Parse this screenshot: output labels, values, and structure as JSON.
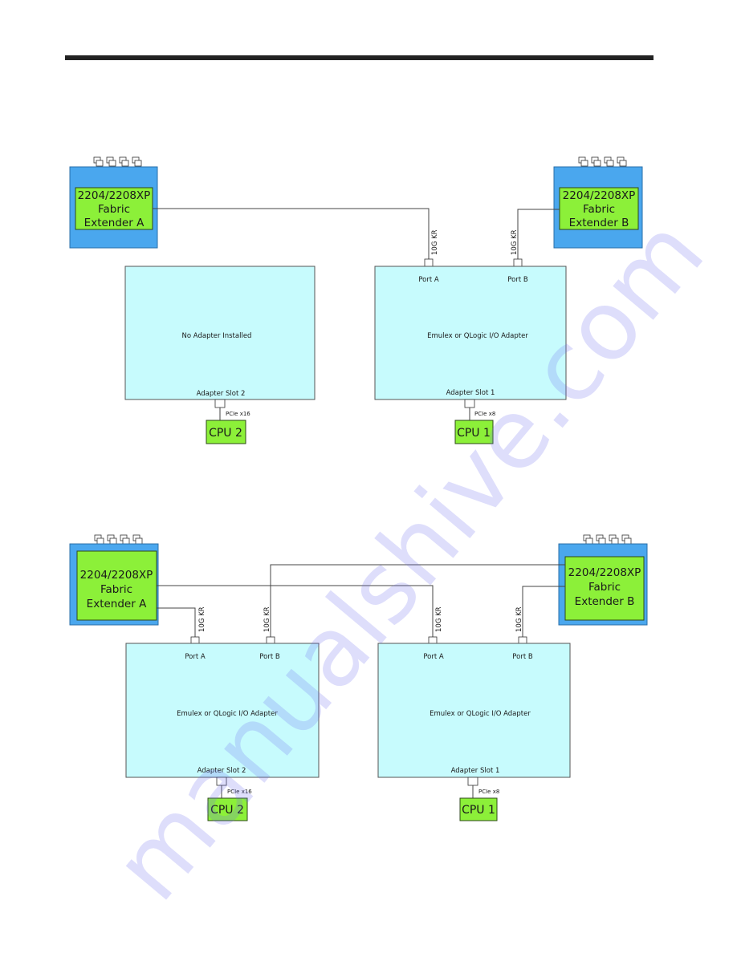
{
  "page": {
    "watermark": "manualshive.com"
  },
  "colors": {
    "fex_outer": "#4aa7ee",
    "fex_inner": "#8cf039",
    "adapter_fill": "#c7fbfd",
    "cpu_fill": "#8cf039",
    "wire": "#444444",
    "rule": "#222222"
  },
  "diagrams": [
    {
      "fex_a": {
        "lines": [
          "2204/2208XP",
          "Fabric",
          "Extender A"
        ]
      },
      "fex_b": {
        "lines": [
          "2204/2208XP",
          "Fabric",
          "Extender B"
        ]
      },
      "links": [
        {
          "label": "10G KR",
          "from": "Fabric Extender A",
          "to": "Adapter Slot 1 Port A"
        },
        {
          "label": "10G KR",
          "from": "Fabric Extender B",
          "to": "Adapter Slot 1 Port B"
        }
      ],
      "adapters": [
        {
          "slot": "Adapter Slot 2",
          "name": "No  Adapter Installed",
          "ports": [],
          "bus": "PCIe x16",
          "cpu": "CPU 2"
        },
        {
          "slot": "Adapter Slot 1",
          "name": "Emulex or QLogic I/O Adapter",
          "ports": [
            "Port  A",
            "Port  B"
          ],
          "bus": "PCIe x8",
          "cpu": "CPU 1"
        }
      ]
    },
    {
      "fex_a": {
        "lines": [
          "2204/2208XP",
          "Fabric",
          "Extender A"
        ]
      },
      "fex_b": {
        "lines": [
          "2204/2208XP",
          "Fabric",
          "Extender B"
        ]
      },
      "links": [
        {
          "label": "10G KR",
          "from": "Fabric Extender A",
          "to": "Adapter Slot 2 Port A"
        },
        {
          "label": "10G KR",
          "from": "Fabric Extender B",
          "to": "Adapter Slot 2 Port B"
        },
        {
          "label": "10G KR",
          "from": "Fabric Extender A",
          "to": "Adapter Slot 1 Port A"
        },
        {
          "label": "10G KR",
          "from": "Fabric Extender B",
          "to": "Adapter Slot 1 Port B"
        }
      ],
      "adapters": [
        {
          "slot": "Adapter Slot 2",
          "name": "Emulex or QLogic I/O Adapter",
          "ports": [
            "Port  A",
            "Port  B"
          ],
          "bus": "PCIe x16",
          "cpu": "CPU 2"
        },
        {
          "slot": "Adapter Slot 1",
          "name": "Emulex or QLogic I/O Adapter",
          "ports": [
            "Port  A",
            "Port  B"
          ],
          "bus": "PCIe x8",
          "cpu": "CPU 1"
        }
      ]
    }
  ]
}
